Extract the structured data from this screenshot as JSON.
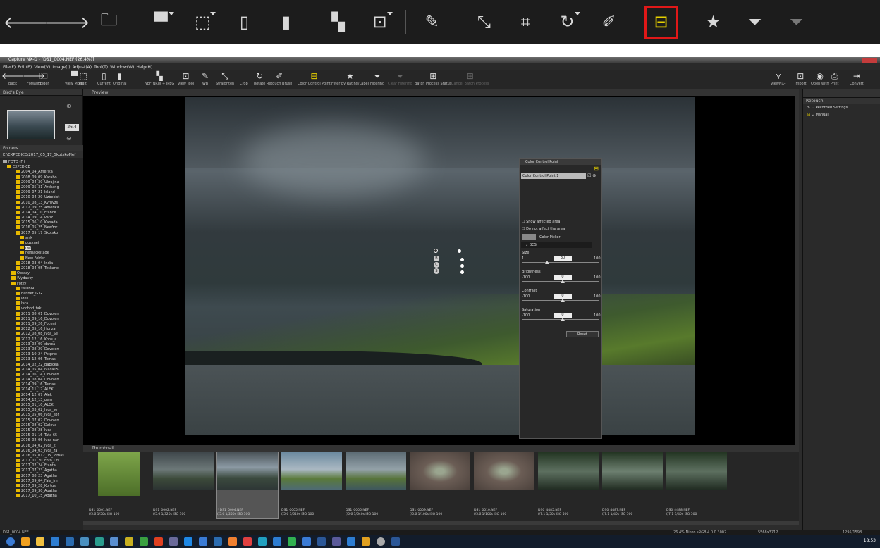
{
  "top_toolbar": {
    "buttons": [
      {
        "name": "back",
        "icon": "arrow-left-icon",
        "glyph": "🡐"
      },
      {
        "name": "forward",
        "icon": "arrow-right-icon",
        "glyph": "🡒"
      },
      {
        "name": "folder",
        "icon": "folder-icon",
        "glyph": "🗀"
      },
      {
        "name": "view-mode",
        "icon": "view-mode-icon",
        "glyph": "▀"
      },
      {
        "name": "multi",
        "icon": "multi-icon",
        "glyph": "⬚"
      },
      {
        "name": "current",
        "icon": "current-icon",
        "glyph": "▯"
      },
      {
        "name": "original",
        "icon": "original-icon",
        "glyph": "▮"
      },
      {
        "name": "nef-raw",
        "icon": "layers-icon",
        "glyph": "▚"
      },
      {
        "name": "view-tool",
        "icon": "view-tool-icon",
        "glyph": "⊡"
      },
      {
        "name": "wb",
        "icon": "eyedropper-icon",
        "glyph": "✎"
      },
      {
        "name": "straighten",
        "icon": "straighten-icon",
        "glyph": "⤡"
      },
      {
        "name": "crop",
        "icon": "crop-icon",
        "glyph": "⌗"
      },
      {
        "name": "rotate",
        "icon": "rotate-icon",
        "glyph": "↻"
      },
      {
        "name": "retouch-brush",
        "icon": "bandage-icon",
        "glyph": "✐"
      },
      {
        "name": "color-control-point",
        "icon": "color-control-point-icon",
        "glyph": "⊟",
        "highlighted": true
      },
      {
        "name": "filter-rating",
        "icon": "star-icon",
        "glyph": "★"
      },
      {
        "name": "filtering",
        "icon": "funnel-icon",
        "glyph": "⏷"
      },
      {
        "name": "clear-filtering",
        "icon": "funnel-clear-icon",
        "glyph": "⏷"
      }
    ],
    "highlight_color": "#e01818"
  },
  "app": {
    "title": "Capture NX-D - [DS1_0004.NEF (26.4%)]",
    "menu": [
      "File(F)",
      "Edit(E)",
      "View(V)",
      "Image(I)",
      "Adjust(A)",
      "Tool(T)",
      "Window(W)",
      "Help(H)"
    ],
    "toolbar_labels": [
      "Back",
      "Forward",
      "Folder",
      "View Mode",
      "Multi",
      "Current",
      "Original",
      "NEF/NRW + JPEG",
      "View Tool",
      "WB",
      "Straighten",
      "Crop",
      "Rotate",
      "Retouch Brush",
      "Color Control Point",
      "Filter by Rating/Label",
      "Filtering",
      "Clear Filtering",
      "Batch Process Status",
      "Cancel Batch Process"
    ],
    "toolbar_right_labels": [
      "ViewNX-i",
      "Import",
      "Open with",
      "Print",
      "Convert"
    ],
    "birds_eye": {
      "title": "Bird's Eye",
      "zoom": "26.4"
    },
    "folders": {
      "title": "Folders",
      "path": "E:\\EXPEDICE\\2017_05_17_SkotskoNef",
      "items": [
        "FOTO (F:)",
        "EXPEDICE",
        "2004_04_Amerika",
        "2008_09_09_Karabo",
        "2009_04_30_Ukrajina",
        "2009_05_31_Archang",
        "2009_07_21_Island",
        "2010_04_20_Uzbekist",
        "2010_08_13_Kyrgyzs",
        "2012_09_25_Amerika",
        "2014_04_10_France",
        "2014_09_14_Pariz",
        "2015_06_10_Kanada",
        "2016_05_25_NewYor",
        "2017_05_17_Skotsko",
        "snik",
        "puzznef",
        "nef",
        "nefbackstage",
        "New Folder",
        "2018_03_04_India",
        "2018_04_05_Teskane",
        "Obrazy",
        "!Vydavky",
        "Fotky",
        "!MOBIR",
        "banner_G.G",
        "ideli",
        "lvca",
        "vochod_tak",
        "2011_08_01_Dovolen",
        "2011_09_16_Dovolen",
        "2011_09_26_Foceni",
        "2012_05_16_Honza",
        "2012_08_08_Ivca_Se",
        "2012_12_16_Kons_a",
        "2013_02_09_danca",
        "2013_08_29_Dovolen",
        "2013_10_24_Petprot",
        "2013_12_06_Tomas",
        "2014_02_22_Babicka",
        "2014_05_04_Ivaca15",
        "2014_06_14_Dovolen",
        "2014_08_04_Dovolen",
        "2014_09_16_Tomas",
        "2014_11_17_ALEK",
        "2014_12_07_Alek",
        "2014_12_13_pern",
        "2015_01_10_ALEK",
        "2015_03_02_Ivca_se",
        "2015_05_06_Ivca_kor",
        "2015_07_02_Dovolen",
        "2015_08_02_Daleva",
        "2015_08_28_Ivca",
        "2015_01_16_Tata 65",
        "2016_02_06_Ivca nar",
        "2016_04_02_Ivca_k",
        "2016_04_03_Ivca_za",
        "2016_05_012_05_Tomas",
        "2017_01_20_Foto_Oti",
        "2017_02_24_Franta",
        "2017_07_23_Agatha",
        "2017_08_23_Agatha",
        "2017_09_04_Faja_jm",
        "2017_09_28_Kortus",
        "2017_09_30_Agatha",
        "2017_10_15_Agatha"
      ]
    },
    "preview_title": "Preview",
    "ccp": {
      "title": "Color Control Point",
      "point_name": "Color Control Point 1",
      "show_affected": "Show affected area",
      "do_not_affect": "Do not affect the area",
      "color_picker": "Color Picker",
      "section": "BCS",
      "size": {
        "label": "Size",
        "min": "1",
        "max": "100",
        "value": "30"
      },
      "brightness": {
        "label": "Brightness",
        "min": "-100",
        "max": "100",
        "value": "0"
      },
      "contrast": {
        "label": "Contrast",
        "min": "-100",
        "max": "100",
        "value": "0"
      },
      "saturation": {
        "label": "Saturation",
        "min": "-100",
        "max": "100",
        "value": "0"
      },
      "reset": "Reset"
    },
    "thumbnail_title": "Thumbnail",
    "thumbnails": [
      {
        "file": "DS1_0001.NEF",
        "info": "f/5.6 1/50s ISO 100",
        "color": "linear-gradient(#7ea54a,#4c6e28)"
      },
      {
        "file": "DS1_0002.NEF",
        "info": "f/5.6 1/320s ISO 100",
        "color": "linear-gradient(#3f474b,#6c7878 45%,#3c4a3a 70%,#2b3232)"
      },
      {
        "file": "* DS1_0004.NEF",
        "info": "f/5.6 1/250s ISO 100",
        "color": "linear-gradient(#4a5358,#8c9aa4 40%,#3b4a3e 68%,#2d3535)"
      },
      {
        "file": "DS1_0005.NEF",
        "info": "f/5.6 1/640s ISO 100",
        "color": "linear-gradient(#6c8aa0,#aab8c2 45%,#5a7a3a 70%,#4d6a78)"
      },
      {
        "file": "DS1_0006.NEF",
        "info": "f/5.6 1/640s ISO 100",
        "color": "linear-gradient(#5d6c75,#93a1a8 45%,#57733a 70%,#3d5560)"
      },
      {
        "file": "DS1_0009.NEF",
        "info": "f/5.6 1/100s ISO 100",
        "color": "radial-gradient(#9aa58f 10%,#6b5d55 40%,#4a403b)"
      },
      {
        "file": "DS1_0010.NEF",
        "info": "f/5.6 1/100s ISO 100",
        "color": "radial-gradient(#9aa58f 10%,#6b5d55 40%,#4a403b)"
      },
      {
        "file": "DS0_4485.NEF",
        "info": "f/7.1 1/50s ISO 500",
        "color": "linear-gradient(#233522,#5d7060 50%,#1f2a20)"
      },
      {
        "file": "DS0_4487.NEF",
        "info": "f/7.1 1/40s ISO 500",
        "color": "linear-gradient(#233522,#6d8070 50%,#1f2a20)"
      },
      {
        "file": "DS0_4488.NEF",
        "info": "f/7.1 1/40s ISO 500",
        "color": "linear-gradient(#233522,#5d7060 50%,#1f2a20)"
      }
    ],
    "retouch": {
      "title": "Retouch",
      "recorded": "Recorded Settings",
      "manual": "Manual"
    },
    "status": {
      "file": "DS1_0004.NEF",
      "zoom_info": "26.4%   Nikon sRGB 4.0.0.3002",
      "dims": "5568x3712",
      "count": "1295/1598"
    },
    "clock": "18:53"
  }
}
